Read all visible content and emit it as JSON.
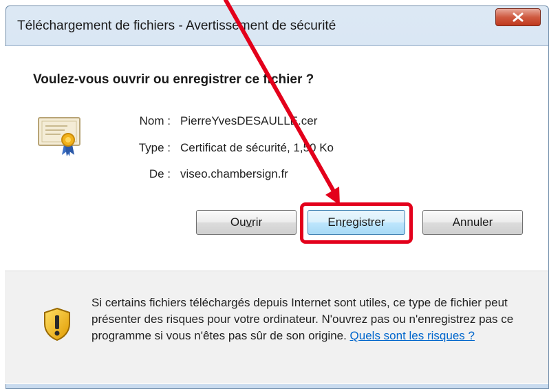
{
  "window": {
    "title": "Téléchargement de fichiers - Avertissement de sécurité",
    "close_label": "X"
  },
  "dialog": {
    "question": "Voulez-vous ouvrir ou enregistrer ce fichier ?",
    "fields": [
      {
        "label": "Nom :",
        "value": "PierreYvesDESAULLE.cer"
      },
      {
        "label": "Type :",
        "value": "Certificat de sécurité, 1,50 Ko"
      },
      {
        "label": "De :",
        "value": "viseo.chambersign.fr"
      }
    ],
    "buttons": {
      "open": {
        "before": "Ou",
        "mnemonic": "v",
        "after": "rir"
      },
      "save": {
        "before": "En",
        "mnemonic": "r",
        "after": "egistrer"
      },
      "cancel": {
        "label": "Annuler"
      }
    }
  },
  "warning": {
    "text": "Si certains fichiers téléchargés depuis Internet sont utiles, ce type de fichier peut présenter des risques pour votre ordinateur. N'ouvrez pas ou n'enregistrez pas ce programme si vous n'êtes pas sûr de son origine. ",
    "link": "Quels sont les risques ?"
  },
  "colors": {
    "annotation_red": "#e3001b",
    "link_blue": "#0066cc",
    "default_button_border": "#3c7fb1"
  },
  "icons": [
    "close-icon",
    "certificate-icon",
    "shield-warning-icon",
    "red-arrow-annotation"
  ]
}
